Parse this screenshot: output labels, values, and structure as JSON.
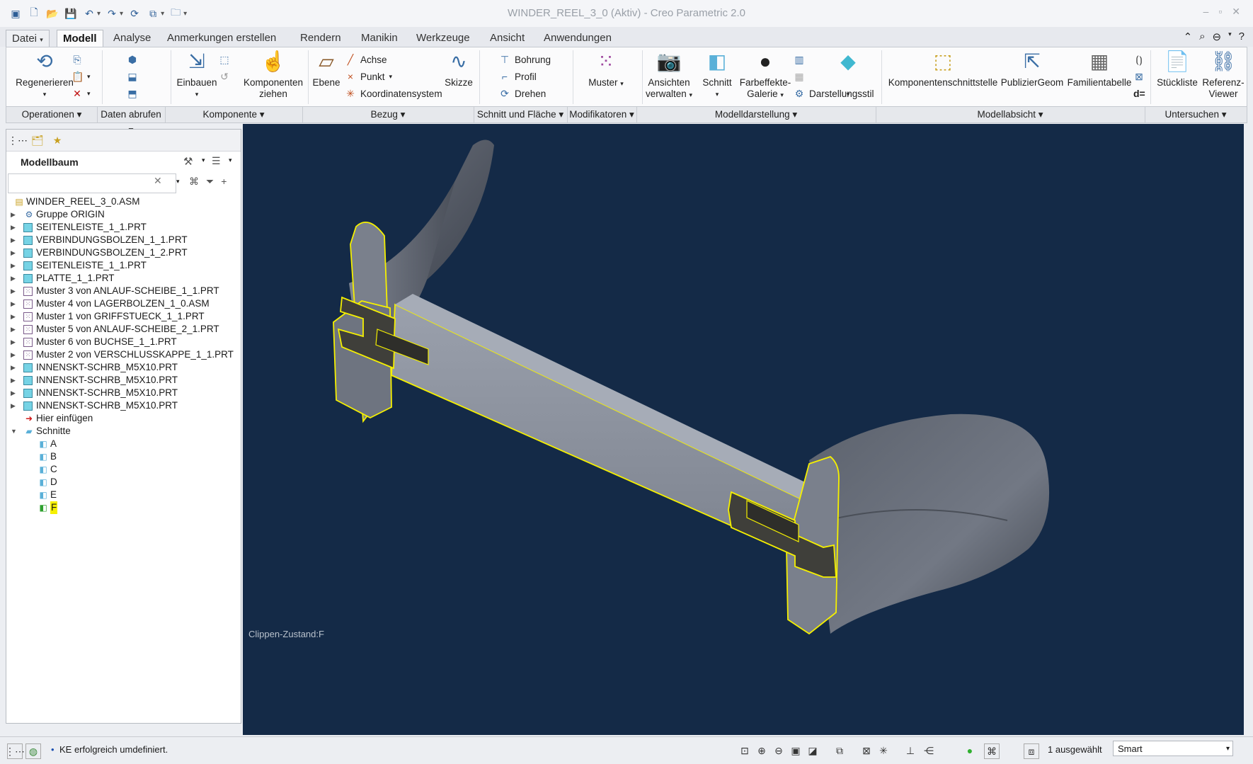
{
  "window": {
    "title": "WINDER_REEL_3_0 (Aktiv) - Creo Parametric 2.0"
  },
  "tabs": [
    {
      "label": "Datei",
      "arrow": "▾"
    },
    {
      "label": "Modell"
    },
    {
      "label": "Analyse"
    },
    {
      "label": "Anmerkungen erstellen"
    },
    {
      "label": "Rendern"
    },
    {
      "label": "Manikin"
    },
    {
      "label": "Werkzeuge"
    },
    {
      "label": "Ansicht"
    },
    {
      "label": "Anwendungen"
    }
  ],
  "ribbon": {
    "regenerieren": "Regenerieren",
    "einbauen": "Einbauen",
    "komponenten_ziehen_1": "Komponenten",
    "komponenten_ziehen_2": "ziehen",
    "ebene": "Ebene",
    "achse": "Achse",
    "punkt": "Punkt",
    "koordinatensystem": "Koordinatensystem",
    "skizze": "Skizze",
    "bohrung": "Bohrung",
    "profil": "Profil",
    "drehen": "Drehen",
    "muster": "Muster",
    "ansichten_1": "Ansichten",
    "ansichten_2": "verwalten",
    "schnitt": "Schnitt",
    "farbeffekte_1": "Farbeffekte-",
    "farbeffekte_2": "Galerie",
    "darstellungsstil": "Darstellungsstil",
    "komponentenschnittstelle": "Komponentenschnittstelle",
    "publiziergeom": "PublizierGeom",
    "familientabelle": "Familientabelle",
    "stueckliste": "Stückliste",
    "referenz_1": "Referenz-",
    "referenz_2": "Viewer"
  },
  "groups": [
    {
      "label": "Operationen ▾"
    },
    {
      "label": "Daten abrufen ▾"
    },
    {
      "label": "Komponente ▾"
    },
    {
      "label": "Bezug ▾"
    },
    {
      "label": "Schnitt und Fläche ▾"
    },
    {
      "label": "Modifikatoren ▾"
    },
    {
      "label": "Modelldarstellung ▾"
    },
    {
      "label": "Modellabsicht ▾"
    },
    {
      "label": "Untersuchen ▾"
    }
  ],
  "modelltree": {
    "title": "Modellbaum",
    "search_placeholder": "",
    "items": [
      {
        "label": "WINDER_REEL_3_0.ASM",
        "type": "asm",
        "depth": 0,
        "toggle": ""
      },
      {
        "label": "Gruppe ORIGIN",
        "type": "grp",
        "depth": 1,
        "toggle": "▶"
      },
      {
        "label": "SEITENLEISTE_1_1.PRT",
        "type": "prt",
        "depth": 1,
        "toggle": "▶"
      },
      {
        "label": "VERBINDUNGSBOLZEN_1_1.PRT",
        "type": "prt",
        "depth": 1,
        "toggle": "▶"
      },
      {
        "label": "VERBINDUNGSBOLZEN_1_2.PRT",
        "type": "prt",
        "depth": 1,
        "toggle": "▶"
      },
      {
        "label": "SEITENLEISTE_1_1.PRT",
        "type": "prt",
        "depth": 1,
        "toggle": "▶"
      },
      {
        "label": "PLATTE_1_1.PRT",
        "type": "prt",
        "depth": 1,
        "toggle": "▶"
      },
      {
        "label": "Muster 3 von ANLAUF-SCHEIBE_1_1.PRT",
        "type": "pat",
        "depth": 1,
        "toggle": "▶"
      },
      {
        "label": "Muster 4 von LAGERBOLZEN_1_0.ASM",
        "type": "pat",
        "depth": 1,
        "toggle": "▶"
      },
      {
        "label": "Muster 1 von GRIFFSTUECK_1_1.PRT",
        "type": "pat",
        "depth": 1,
        "toggle": "▶"
      },
      {
        "label": "Muster 5 von ANLAUF-SCHEIBE_2_1.PRT",
        "type": "pat",
        "depth": 1,
        "toggle": "▶"
      },
      {
        "label": "Muster 6 von BUCHSE_1_1.PRT",
        "type": "pat",
        "depth": 1,
        "toggle": "▶"
      },
      {
        "label": "Muster 2 von VERSCHLUSSKAPPE_1_1.PRT",
        "type": "pat",
        "depth": 1,
        "toggle": "▶"
      },
      {
        "label": "INNENSKT-SCHRB_M5X10.PRT",
        "type": "prt",
        "depth": 1,
        "toggle": "▶"
      },
      {
        "label": "INNENSKT-SCHRB_M5X10.PRT",
        "type": "prt",
        "depth": 1,
        "toggle": "▶"
      },
      {
        "label": "INNENSKT-SCHRB_M5X10.PRT",
        "type": "prt",
        "depth": 1,
        "toggle": "▶"
      },
      {
        "label": "INNENSKT-SCHRB_M5X10.PRT",
        "type": "prt",
        "depth": 1,
        "toggle": "▶"
      },
      {
        "label": "Hier einfügen",
        "type": "ins",
        "depth": 1,
        "toggle": ""
      },
      {
        "label": "Schnitte",
        "type": "folder",
        "depth": 1,
        "toggle": "▼"
      },
      {
        "label": "A",
        "type": "sec",
        "depth": 2,
        "toggle": ""
      },
      {
        "label": "B",
        "type": "sec",
        "depth": 2,
        "toggle": ""
      },
      {
        "label": "C",
        "type": "sec",
        "depth": 2,
        "toggle": ""
      },
      {
        "label": "D",
        "type": "sec",
        "depth": 2,
        "toggle": ""
      },
      {
        "label": "E",
        "type": "sec",
        "depth": 2,
        "toggle": ""
      },
      {
        "label": "F",
        "type": "sec-active",
        "depth": 2,
        "toggle": ""
      }
    ]
  },
  "viewport": {
    "clip_state": "Clippen-Zustand:F"
  },
  "status": {
    "message": "KE erfolgreich umdefiniert.",
    "selected": "1 ausgewählt",
    "filter": "Smart"
  },
  "colors": {
    "viewport_bg": "#142a47",
    "highlight": "#f5f000",
    "part": "#8a909c",
    "accent": "#3a6ea5"
  }
}
